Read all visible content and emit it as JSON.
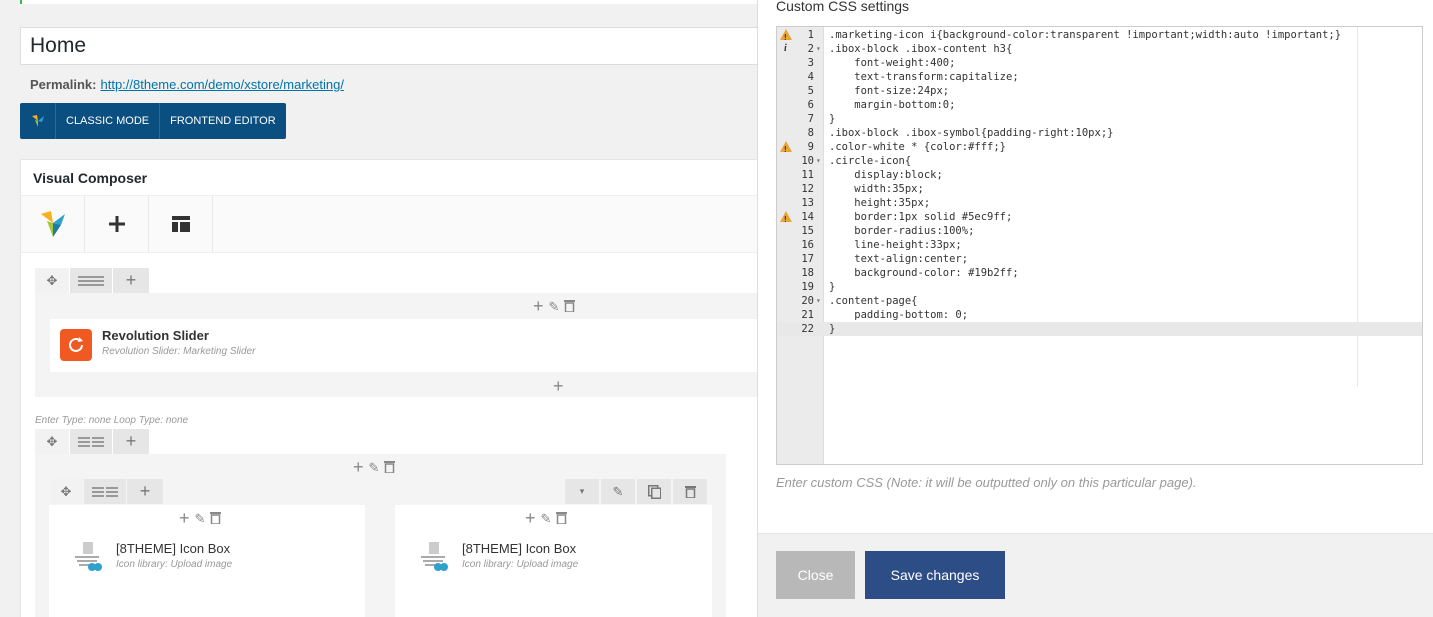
{
  "page": {
    "title_value": "Home",
    "permalink_label": "Permalink:",
    "permalink_url": "http://8theme.com/demo/xstore/marketing/",
    "modes": {
      "classic": "CLASSIC MODE",
      "frontend": "FRONTEND EDITOR"
    }
  },
  "composer": {
    "heading": "Visual Composer",
    "toolbar_icons": [
      "vc-logo-icon",
      "plus-icon",
      "template-icon"
    ],
    "rows": [
      {
        "element_title": "Revolution Slider",
        "element_subtitle": "Revolution Slider: Marketing Slider"
      },
      {
        "row_note": "Enter Type: none  Loop Type: none"
      }
    ],
    "icon_boxes": [
      {
        "title": "[8THEME] Icon Box",
        "subtitle": "Icon library: Upload image"
      },
      {
        "title": "[8THEME] Icon Box",
        "subtitle": "Icon library: Upload image"
      }
    ]
  },
  "css_panel": {
    "title": "Custom CSS settings",
    "code_lines": [
      ".marketing-icon i{background-color:transparent !important;width:auto !important;}",
      ".ibox-block .ibox-content h3{",
      "    font-weight:400;",
      "    text-transform:capitalize;",
      "    font-size:24px;",
      "    margin-bottom:0;",
      "}",
      ".ibox-block .ibox-symbol{padding-right:10px;}",
      ".color-white * {color:#fff;}",
      ".circle-icon{",
      "    display:block;",
      "    width:35px;",
      "    height:35px;",
      "    border:1px solid #5ec9ff;",
      "    border-radius:100%;",
      "    line-height:33px;",
      "    text-align:center;",
      "    background-color: #19b2ff;",
      "}",
      ".content-page{",
      "    padding-bottom: 0;",
      "}"
    ],
    "line_numbers": [
      "1",
      "2",
      "3",
      "4",
      "5",
      "6",
      "7",
      "8",
      "9",
      "10",
      "11",
      "12",
      "13",
      "14",
      "15",
      "16",
      "17",
      "18",
      "19",
      "20",
      "21",
      "22"
    ],
    "warning_lines": [
      1,
      9,
      14
    ],
    "info_lines": [
      2
    ],
    "fold_lines": [
      2,
      10,
      20
    ],
    "active_line": 22,
    "help_text": "Enter custom CSS (Note: it will be outputted only on this particular page).",
    "close_label": "Close",
    "save_label": "Save changes"
  },
  "colors": {
    "accent": "#0b4e80",
    "save": "#2d4d86",
    "close": "#b8b8b8",
    "slider_icon": "#f05a22"
  }
}
